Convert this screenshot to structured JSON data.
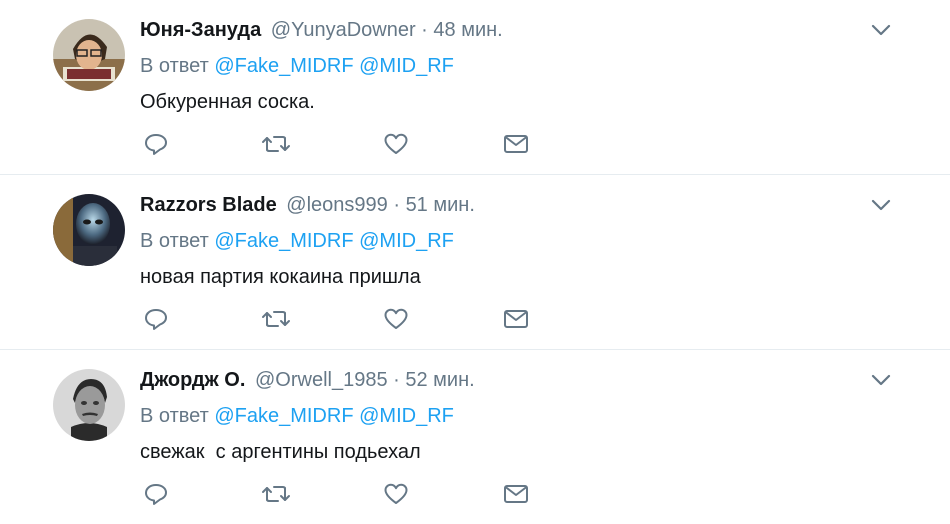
{
  "tweets": [
    {
      "name": "Юня-Зануда",
      "handle": "@YunyaDowner",
      "separator": "·",
      "time": "48 мин.",
      "reply_prefix": "В ответ",
      "mentions": [
        "@Fake_MIDRF",
        "@MID_RF"
      ],
      "text": "Обкуренная соска."
    },
    {
      "name": "Razzors Blade",
      "handle": "@leons999",
      "separator": "·",
      "time": "51 мин.",
      "reply_prefix": "В ответ",
      "mentions": [
        "@Fake_MIDRF",
        "@MID_RF"
      ],
      "text": "новая партия кокаина пришла"
    },
    {
      "name": "Джордж О.",
      "handle": "@Orwell_1985",
      "separator": "·",
      "time": "52 мин.",
      "reply_prefix": "В ответ",
      "mentions": [
        "@Fake_MIDRF",
        "@MID_RF"
      ],
      "text": "свежак  с аргентины подьехал"
    }
  ],
  "icons": {
    "caret": "chevron-down-icon",
    "reply": "reply-icon",
    "retweet": "retweet-icon",
    "like": "heart-icon",
    "dm": "envelope-icon"
  },
  "colors": {
    "text": "#14171a",
    "muted": "#657786",
    "link": "#1da1f2",
    "divider": "#e6ecf0"
  }
}
